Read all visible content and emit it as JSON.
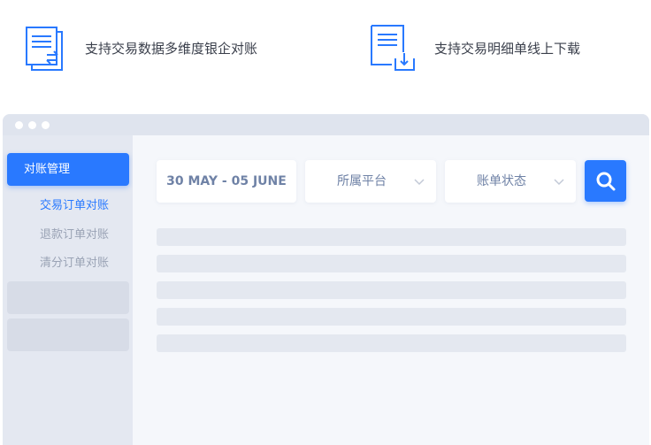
{
  "features": [
    {
      "icon": "document-exchange-icon",
      "text": "支持交易数据多维度银企对账"
    },
    {
      "icon": "document-download-icon",
      "text": "支持交易明细单线上下载"
    }
  ],
  "sidebar": {
    "active_item": "对账管理",
    "sub_items": [
      {
        "label": "交易订单对账",
        "active": true
      },
      {
        "label": "退款订单对账",
        "active": false
      },
      {
        "label": "清分订单对账",
        "active": false
      }
    ]
  },
  "filters": {
    "date_range": "30 MAY - 05 JUNE",
    "platform": "所属平台",
    "status": "账单状态"
  },
  "colors": {
    "accent": "#2979ff",
    "muted_text": "#9aa3b5",
    "filter_text": "#6f82a6",
    "window_bg": "#e4e8f1"
  }
}
